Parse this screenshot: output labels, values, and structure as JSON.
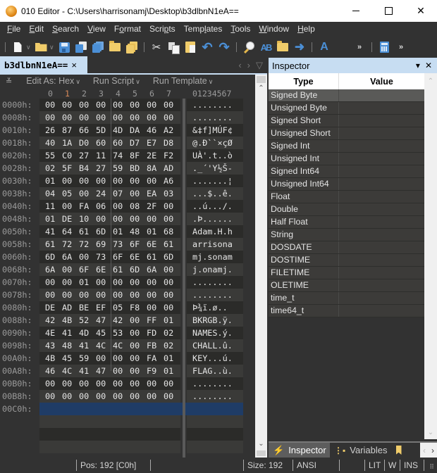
{
  "window": {
    "title": "010 Editor - C:\\Users\\harrisonamj\\Desktop\\b3dlbnN1eA==",
    "controls": {
      "minimize": "",
      "maximize": "",
      "close": "✕"
    }
  },
  "menu": [
    {
      "label": "File",
      "accel": "F",
      "rest": "ile"
    },
    {
      "label": "Edit",
      "accel": "E",
      "rest": "dit"
    },
    {
      "label": "Search",
      "accel": "S",
      "rest": "earch"
    },
    {
      "label": "View",
      "accel": "V",
      "rest": "iew"
    },
    {
      "label": "Format",
      "pre": "F",
      "accel": "o",
      "rest": "rmat"
    },
    {
      "label": "Scripts",
      "pre": "Scri",
      "accel": "p",
      "rest": "ts"
    },
    {
      "label": "Templates",
      "pre": "Temp",
      "accel": "l",
      "rest": "ates"
    },
    {
      "label": "Tools",
      "accel": "T",
      "rest": "ools"
    },
    {
      "label": "Window",
      "accel": "W",
      "rest": "indow"
    },
    {
      "label": "Help",
      "accel": "H",
      "rest": "elp"
    }
  ],
  "toolbar": {
    "icons": [
      "new-file-icon",
      "open-folder-icon",
      "save-icon",
      "save-as-icon",
      "save-all-icon",
      "open-folder-2-icon",
      "open-workspace-icon",
      "cut-icon",
      "copy-icon",
      "paste-icon",
      "undo-icon",
      "redo-icon",
      "find-icon",
      "replace-icon",
      "find-in-files-icon",
      "goto-icon",
      "font-icon",
      "more-icon",
      "calculator-icon",
      "more-icon"
    ],
    "more_glyph": "»"
  },
  "editor": {
    "tab_label": "b3dlbnN1eA==",
    "tab_close": "×",
    "tab_nav": {
      "prev": "‹",
      "next": "›",
      "menu": "▽"
    },
    "edit_as_label": "Edit As: Hex",
    "run_script_label": "Run Script",
    "run_template_label": "Run Template",
    "collapse_glyph": "≚",
    "chevron": "∨",
    "hex_columns": [
      "0",
      "1",
      "2",
      "3",
      "4",
      "5",
      "6",
      "7"
    ],
    "ascii_header": "01234567",
    "rows": [
      {
        "addr": "0000h:",
        "bytes": [
          "00",
          "00",
          "00",
          "00",
          "00",
          "00",
          "00",
          "00"
        ],
        "ascii": "........"
      },
      {
        "addr": "0008h:",
        "bytes": [
          "00",
          "00",
          "00",
          "00",
          "00",
          "00",
          "00",
          "00"
        ],
        "ascii": "........"
      },
      {
        "addr": "0010h:",
        "bytes": [
          "26",
          "87",
          "66",
          "5D",
          "4D",
          "DA",
          "46",
          "A2"
        ],
        "ascii": "&‡f]MÚF¢"
      },
      {
        "addr": "0018h:",
        "bytes": [
          "40",
          "1A",
          "D0",
          "60",
          "60",
          "D7",
          "E7",
          "D8"
        ],
        "ascii": "@.Ð``×çØ"
      },
      {
        "addr": "0020h:",
        "bytes": [
          "55",
          "C0",
          "27",
          "11",
          "74",
          "8F",
          "2E",
          "F2"
        ],
        "ascii": "UÀ'.t..ò"
      },
      {
        "addr": "0028h:",
        "bytes": [
          "02",
          "5F",
          "B4",
          "27",
          "59",
          "BD",
          "8A",
          "AD"
        ],
        "ascii": "._´'Y½Š-"
      },
      {
        "addr": "0030h:",
        "bytes": [
          "01",
          "00",
          "00",
          "00",
          "00",
          "00",
          "00",
          "A6"
        ],
        "ascii": ".......¦"
      },
      {
        "addr": "0038h:",
        "bytes": [
          "04",
          "05",
          "00",
          "24",
          "07",
          "00",
          "EA",
          "03"
        ],
        "ascii": "...$..ê."
      },
      {
        "addr": "0040h:",
        "bytes": [
          "11",
          "00",
          "FA",
          "06",
          "00",
          "08",
          "2F",
          "00"
        ],
        "ascii": "..ú.../."
      },
      {
        "addr": "0048h:",
        "bytes": [
          "01",
          "DE",
          "10",
          "00",
          "00",
          "00",
          "00",
          "00"
        ],
        "ascii": ".Þ......"
      },
      {
        "addr": "0050h:",
        "bytes": [
          "41",
          "64",
          "61",
          "6D",
          "01",
          "48",
          "01",
          "68"
        ],
        "ascii": "Adam.H.h"
      },
      {
        "addr": "0058h:",
        "bytes": [
          "61",
          "72",
          "72",
          "69",
          "73",
          "6F",
          "6E",
          "61"
        ],
        "ascii": "arrisona"
      },
      {
        "addr": "0060h:",
        "bytes": [
          "6D",
          "6A",
          "00",
          "73",
          "6F",
          "6E",
          "61",
          "6D"
        ],
        "ascii": "mj.sonam"
      },
      {
        "addr": "0068h:",
        "bytes": [
          "6A",
          "00",
          "6F",
          "6E",
          "61",
          "6D",
          "6A",
          "00"
        ],
        "ascii": "j.onamj."
      },
      {
        "addr": "0070h:",
        "bytes": [
          "00",
          "00",
          "01",
          "00",
          "00",
          "00",
          "00",
          "00"
        ],
        "ascii": "........"
      },
      {
        "addr": "0078h:",
        "bytes": [
          "00",
          "00",
          "00",
          "00",
          "00",
          "00",
          "00",
          "00"
        ],
        "ascii": "........"
      },
      {
        "addr": "0080h:",
        "bytes": [
          "DE",
          "AD",
          "BE",
          "EF",
          "05",
          "F8",
          "00",
          "00"
        ],
        "ascii": "Þ­¾ï.ø.."
      },
      {
        "addr": "0088h:",
        "bytes": [
          "42",
          "4B",
          "52",
          "47",
          "42",
          "00",
          "FF",
          "01"
        ],
        "ascii": "BKRGB.ÿ."
      },
      {
        "addr": "0090h:",
        "bytes": [
          "4E",
          "41",
          "4D",
          "45",
          "53",
          "00",
          "FD",
          "02"
        ],
        "ascii": "NAMES.ý."
      },
      {
        "addr": "0098h:",
        "bytes": [
          "43",
          "48",
          "41",
          "4C",
          "4C",
          "00",
          "FB",
          "02"
        ],
        "ascii": "CHALL.û."
      },
      {
        "addr": "00A0h:",
        "bytes": [
          "4B",
          "45",
          "59",
          "00",
          "00",
          "00",
          "FA",
          "01"
        ],
        "ascii": "KEY...ú."
      },
      {
        "addr": "00A8h:",
        "bytes": [
          "46",
          "4C",
          "41",
          "47",
          "00",
          "00",
          "F9",
          "01"
        ],
        "ascii": "FLAG..ù."
      },
      {
        "addr": "00B0h:",
        "bytes": [
          "00",
          "00",
          "00",
          "00",
          "00",
          "00",
          "00",
          "00"
        ],
        "ascii": "........"
      },
      {
        "addr": "00B8h:",
        "bytes": [
          "00",
          "00",
          "00",
          "00",
          "00",
          "00",
          "00",
          "00"
        ],
        "ascii": "........"
      },
      {
        "addr": "00C0h:",
        "bytes": [],
        "ascii": ""
      }
    ],
    "cursor_row": 24,
    "scroll": {
      "up": "⌃",
      "down": "⌄"
    }
  },
  "inspector": {
    "title": "Inspector",
    "menu_glyph": "▾",
    "close_glyph": "✕",
    "columns": {
      "type": "Type",
      "value": "Value"
    },
    "rows": [
      {
        "type": "Signed Byte",
        "value": ""
      },
      {
        "type": "Unsigned Byte",
        "value": ""
      },
      {
        "type": "Signed Short",
        "value": ""
      },
      {
        "type": "Unsigned Short",
        "value": ""
      },
      {
        "type": "Signed Int",
        "value": ""
      },
      {
        "type": "Unsigned Int",
        "value": ""
      },
      {
        "type": "Signed Int64",
        "value": ""
      },
      {
        "type": "Unsigned Int64",
        "value": ""
      },
      {
        "type": "Float",
        "value": ""
      },
      {
        "type": "Double",
        "value": ""
      },
      {
        "type": "Half Float",
        "value": ""
      },
      {
        "type": "String",
        "value": ""
      },
      {
        "type": "DOSDATE",
        "value": ""
      },
      {
        "type": "DOSTIME",
        "value": ""
      },
      {
        "type": "FILETIME",
        "value": ""
      },
      {
        "type": "OLETIME",
        "value": ""
      },
      {
        "type": "time_t",
        "value": ""
      },
      {
        "type": "time64_t",
        "value": ""
      }
    ],
    "selected_row": 0,
    "bottom_tabs": [
      {
        "label": "Inspector",
        "icon": "lightning-icon",
        "active": true
      },
      {
        "label": "Variables",
        "icon": "variables-icon",
        "active": false
      },
      {
        "label": "",
        "icon": "bookmark-icon",
        "active": false
      }
    ],
    "tab_nav": {
      "prev": "‹",
      "next": "›"
    }
  },
  "status": {
    "pos": "Pos: 192 [C0h]",
    "size": "Size: 192",
    "encoding": "ANSI",
    "endian": "LIT",
    "write": "W",
    "insert": "INS",
    "grip": "⠿"
  }
}
